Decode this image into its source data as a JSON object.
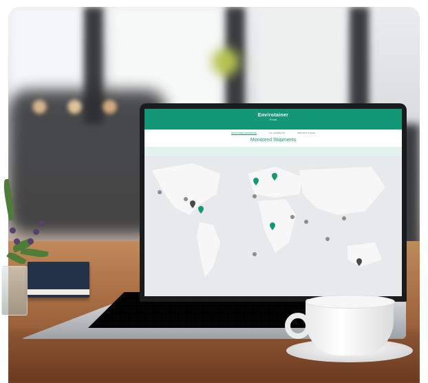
{
  "scene": "laptop on wooden desk displaying shipment tracking map",
  "app": {
    "brand_name": "Envirotainer",
    "brand_sub": "Portal",
    "nav_items": [
      "MONITORED SHIPMENTS",
      "ALL SHIPMENTS",
      "REPORTS & DATA"
    ],
    "active_nav": 0,
    "page_title": "Monitored Shipments",
    "accent_color": "#139776"
  },
  "map": {
    "pin_icon": "map-pin-icon",
    "pin_color_green": "#139776",
    "pin_color_dark": "#4a4a4a"
  }
}
